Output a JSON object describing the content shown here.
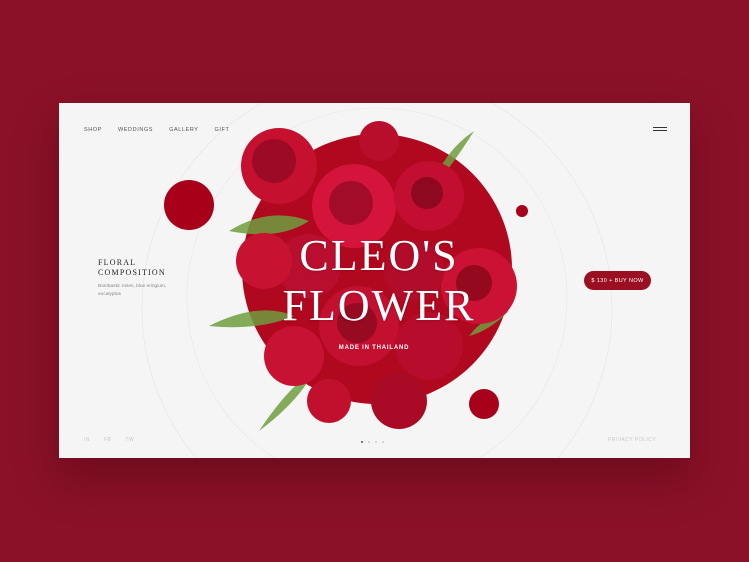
{
  "nav": {
    "items": [
      "SHOP",
      "WEDDINGS",
      "GALLERY",
      "GIFT"
    ]
  },
  "header": {
    "menu_icon": "hamburger-icon"
  },
  "hero": {
    "title_line1": "CLEO'S",
    "title_line2": "FLOWER",
    "subtitle": "MADE IN THAILAND"
  },
  "product": {
    "heading_line1": "FLORAL",
    "heading_line2": "COMPOSITION",
    "description": "Bombastic roses, blue eringium, eucalyptus"
  },
  "cta": {
    "label": "$ 130 + BUY NOW"
  },
  "social": [
    "IN",
    "FB",
    "TW"
  ],
  "footer": {
    "privacy": "PRIVACY POLICY"
  },
  "slider": {
    "count": 4,
    "active": 1
  },
  "colors": {
    "background": "#8a1128",
    "accent": "#9a1022",
    "card": "#f5f5f5"
  }
}
